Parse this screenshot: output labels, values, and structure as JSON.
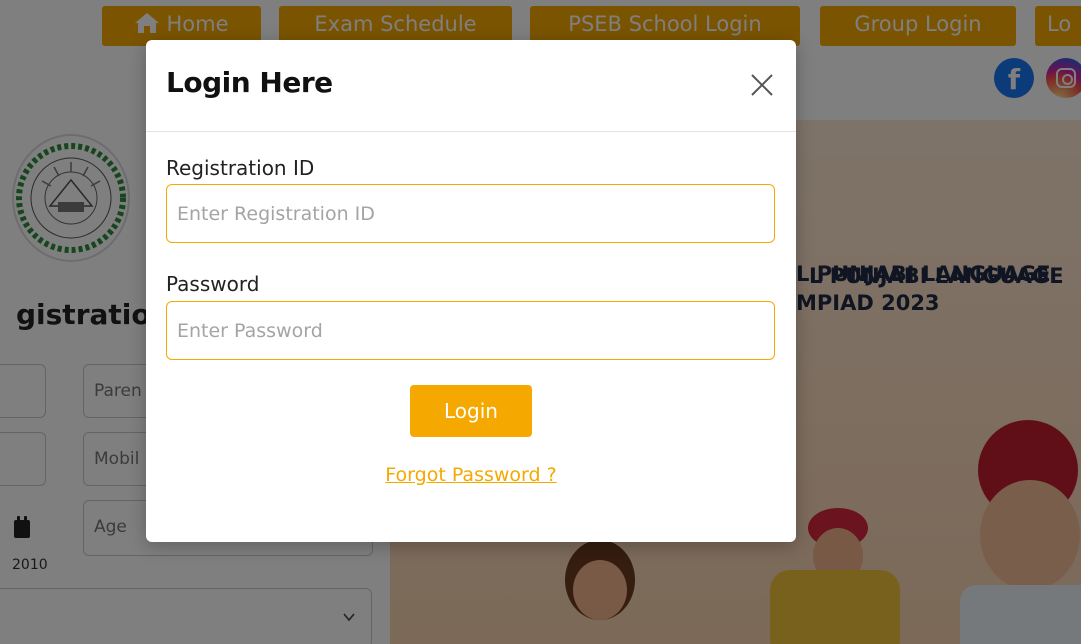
{
  "nav": {
    "home": "Home",
    "exam_schedule": "Exam Schedule",
    "pseb_login": "PSEB School Login",
    "group_login": "Group Login",
    "more": "Lo"
  },
  "social": {
    "facebook_icon": "facebook-icon",
    "instagram_icon": "instagram-icon",
    "facebook_glyph": "f"
  },
  "hero": {
    "title_line1": "L PUNJABI LANGUAGE",
    "title_line2": "MPIAD 2023"
  },
  "registration": {
    "title": "gistration",
    "parent_placeholder": "Paren",
    "mobile_placeholder": "Mobil",
    "age_placeholder": "Age",
    "dob_value": "2010"
  },
  "modal": {
    "title": "Login Here",
    "registration_label": "Registration ID",
    "registration_placeholder": "Enter Registration ID",
    "password_label": "Password",
    "password_placeholder": "Enter Password",
    "login_button": "Login",
    "forgot_link": "Forgot Password ?"
  },
  "colors": {
    "accent": "#f5a800",
    "overlay": "rgba(0,0,0,0.5)",
    "facebook": "#1877f2"
  }
}
